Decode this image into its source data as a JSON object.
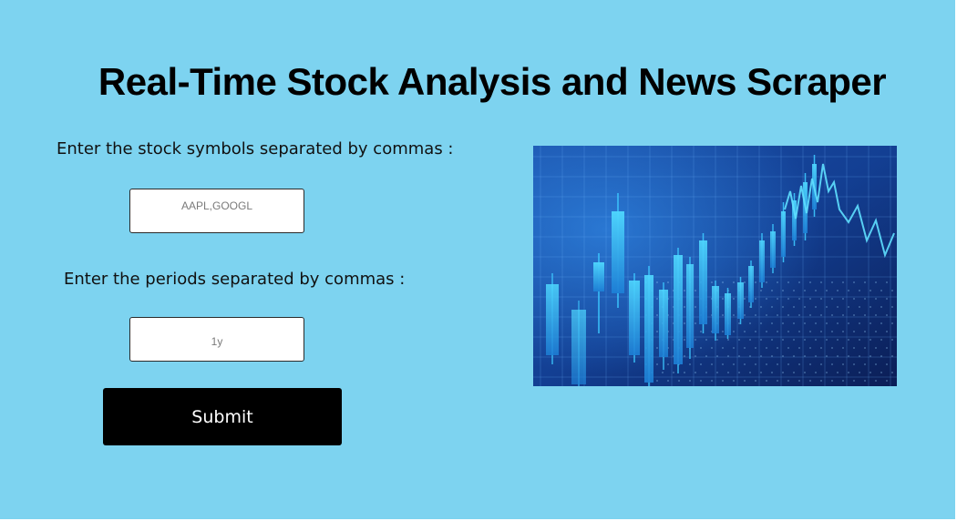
{
  "page": {
    "title": "Real-Time Stock Analysis and News Scraper"
  },
  "form": {
    "symbols_label": "Enter the stock symbols separated by commas :",
    "symbols_placeholder": "AAPL,GOOGL",
    "periods_label": "Enter the periods separated by commas :",
    "periods_placeholder": "1y",
    "submit_label": "Submit"
  },
  "illustration": {
    "icon": "stock-market-candlestick-image",
    "colors": {
      "background_dark": "#0b1e56",
      "background_mid": "#1a4fa8",
      "candle_bright": "#2ec6f5",
      "candle_dim": "#1d7fd6"
    }
  },
  "colors": {
    "page_background": "#7dd3f0",
    "button_background": "#000000",
    "button_text": "#ffffff"
  }
}
